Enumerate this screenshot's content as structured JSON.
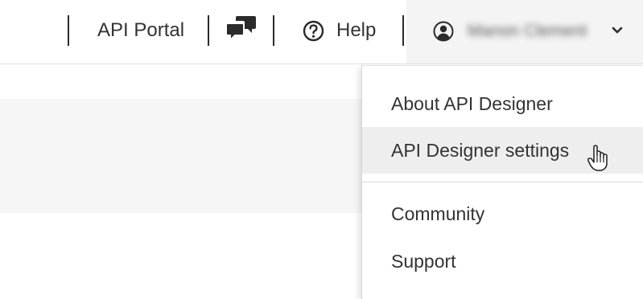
{
  "header": {
    "api_portal_label": "API Portal",
    "help_label": "Help",
    "user_name": "Manon Clement",
    "icons": {
      "chat": "chat-bubbles-icon",
      "help": "question-circle-icon",
      "user": "user-circle-icon",
      "dropdown": "chevron-down-icon"
    }
  },
  "dropdown": {
    "items": [
      {
        "label": "About API Designer"
      },
      {
        "label": "API Designer settings"
      },
      {
        "label": "Community"
      },
      {
        "label": "Support"
      }
    ],
    "hovered_index": 1
  },
  "colors": {
    "text": "#333333",
    "header_user_bg": "#f4f4f4",
    "hover_bg": "#eeeeee",
    "panel_bg": "#f6f6f6"
  }
}
